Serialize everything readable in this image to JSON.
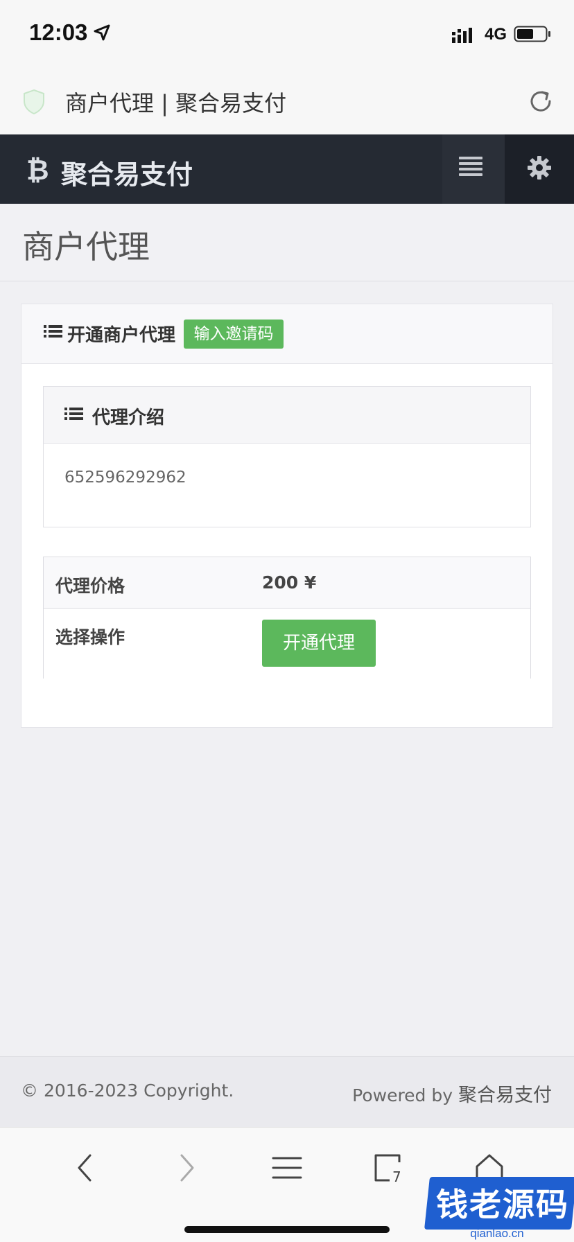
{
  "status_bar": {
    "time": "12:03",
    "network": "4G",
    "battery_level": 0.6
  },
  "browser": {
    "page_title": "商户代理 | 聚合易支付"
  },
  "navbar": {
    "brand": "聚合易支付",
    "brand_icon": "bitcoin-icon"
  },
  "page": {
    "title": "商户代理"
  },
  "panel": {
    "title": "开通商户代理",
    "invite_button": "输入邀请码",
    "intro": {
      "title": "代理介绍",
      "body": "652596292962"
    },
    "table": {
      "price_label": "代理价格",
      "price_value": "200 ¥",
      "action_label": "选择操作",
      "action_button": "开通代理"
    }
  },
  "footer": {
    "copyright": "© 2016-2023 Copyright.",
    "powered_prefix": "Powered by ",
    "powered_brand": "聚合易支付"
  },
  "watermark": {
    "title": "钱老源码",
    "subtitle": "qianlao.cn"
  },
  "colors": {
    "navbar": "#252a33",
    "accent_green": "#5cb85c",
    "watermark_blue": "#1f5fd0"
  }
}
